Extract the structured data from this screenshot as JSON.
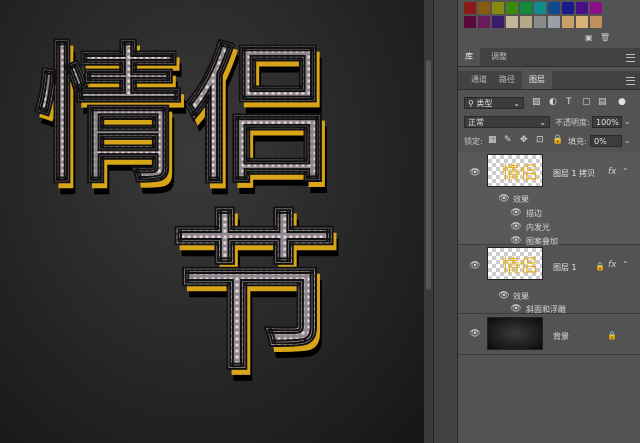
{
  "colors": {
    "swatch_row1": [
      "#8a1a1a",
      "#8a5a10",
      "#8a8a10",
      "#3a8a10",
      "#108a3a",
      "#108a8a",
      "#104a8a",
      "#1a1a8a",
      "#4a108a",
      "#8a108a"
    ],
    "swatch_row2": [
      "#5a0a3a",
      "#6a1a5a",
      "#3a1a6a",
      "#c2b59a",
      "#b8a88a",
      "#8a8a8a",
      "#9aa0a8",
      "#c8a068",
      "#d8b078",
      "#c0905a"
    ],
    "gold": "#e8b020"
  },
  "canvas": {
    "artwork_text_line1": "情侣",
    "artwork_text_line2": "节"
  },
  "panel_tabs": {
    "tab1": "库",
    "tab2": "调整"
  },
  "layer_tabs": {
    "tab1": "通道",
    "tab2": "路径",
    "tab3": "图层"
  },
  "filter": {
    "kind": "类型"
  },
  "blend": {
    "mode": "正常",
    "opacity_label": "不透明度:",
    "opacity_value": "100%"
  },
  "locks": {
    "label": "锁定:",
    "fill_label": "填充:",
    "fill_value": "0%"
  },
  "layers": [
    {
      "name": "图层 1 拷贝",
      "fx": "fx",
      "effects_label": "效果",
      "effects": [
        "描边",
        "内发光",
        "图案叠加"
      ]
    },
    {
      "name": "图层 1",
      "fx": "fx",
      "effects_label": "效果",
      "effects": [
        "斜面和浮雕"
      ]
    },
    {
      "name": "背景"
    }
  ]
}
